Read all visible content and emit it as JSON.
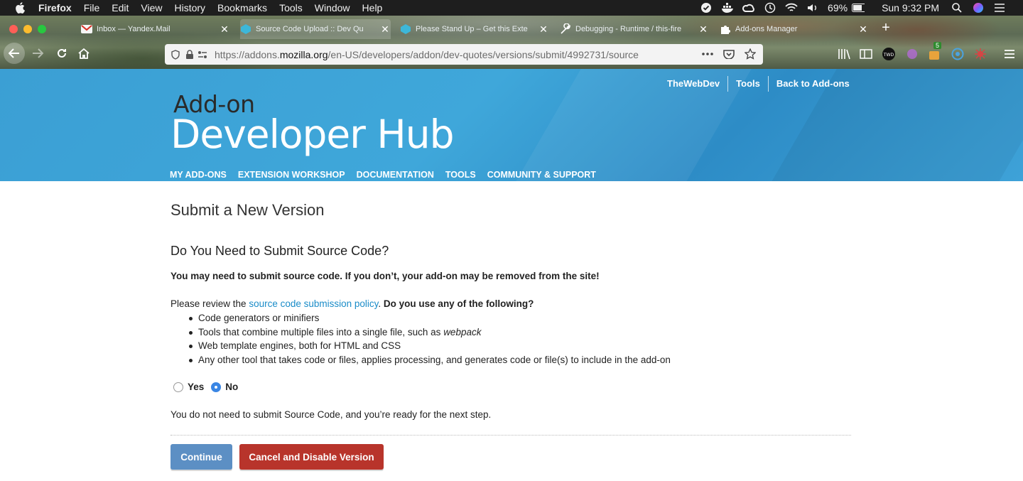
{
  "menubar": {
    "app": "Firefox",
    "items": [
      "File",
      "Edit",
      "View",
      "History",
      "Bookmarks",
      "Tools",
      "Window",
      "Help"
    ],
    "battery": "69%",
    "clock": "Sun 9:32 PM",
    "icons": [
      "apple-icon",
      "lastpass-icon",
      "docker-icon",
      "creative-cloud-icon",
      "time-machine-icon",
      "wifi-icon",
      "volume-icon",
      "battery-icon",
      "spotlight-icon",
      "siri-icon",
      "menu-list-icon"
    ]
  },
  "tabs": [
    {
      "title": "Inbox — Yandex.Mail",
      "icon": "gmail-icon"
    },
    {
      "title": "Source Code Upload :: Dev Qu",
      "icon": "mozilla-addons-icon"
    },
    {
      "title": "Please Stand Up – Get this Exte",
      "icon": "mozilla-addons-icon"
    },
    {
      "title": "Debugging - Runtime / this-fire",
      "icon": "wrench-icon"
    },
    {
      "title": "Add-ons Manager",
      "icon": "puzzle-icon"
    }
  ],
  "urlbar": {
    "prefix": "https://addons.",
    "domain": "mozilla.org",
    "path": "/en-US/developers/addon/dev-quotes/versions/submit/4992731/source"
  },
  "toolbar": {
    "badge": "5",
    "twd_label": "TWD"
  },
  "hub": {
    "top_links": [
      "TheWebDev",
      "Tools",
      "Back to Add-ons"
    ],
    "title_small": "Add-on",
    "title_large": "Developer Hub",
    "nav": [
      "MY ADD-ONS",
      "EXTENSION WORKSHOP",
      "DOCUMENTATION",
      "TOOLS",
      "COMMUNITY & SUPPORT"
    ]
  },
  "page": {
    "heading": "Submit a New Version",
    "subheading": "Do You Need to Submit Source Code?",
    "warning": "You may need to submit source code. If you don’t, your add-on may be removed from the site!",
    "review_prefix": "Please review the ",
    "review_link": "source code submission policy",
    "review_suffix": ". ",
    "review_question": "Do you use any of the following?",
    "bullets": [
      "Code generators or minifiers",
      "Tools that combine multiple files into a single file, such as ",
      "Web template engines, both for HTML and CSS",
      "Any other tool that takes code or files, applies processing, and generates code or file(s) to include in the add-on"
    ],
    "bullet2_em": "webpack",
    "radio_yes": "Yes",
    "radio_no": "No",
    "selected": "No",
    "note": "You do not need to submit Source Code, and you’re ready for the next step.",
    "continue_label": "Continue",
    "cancel_label": "Cancel and Disable Version"
  }
}
